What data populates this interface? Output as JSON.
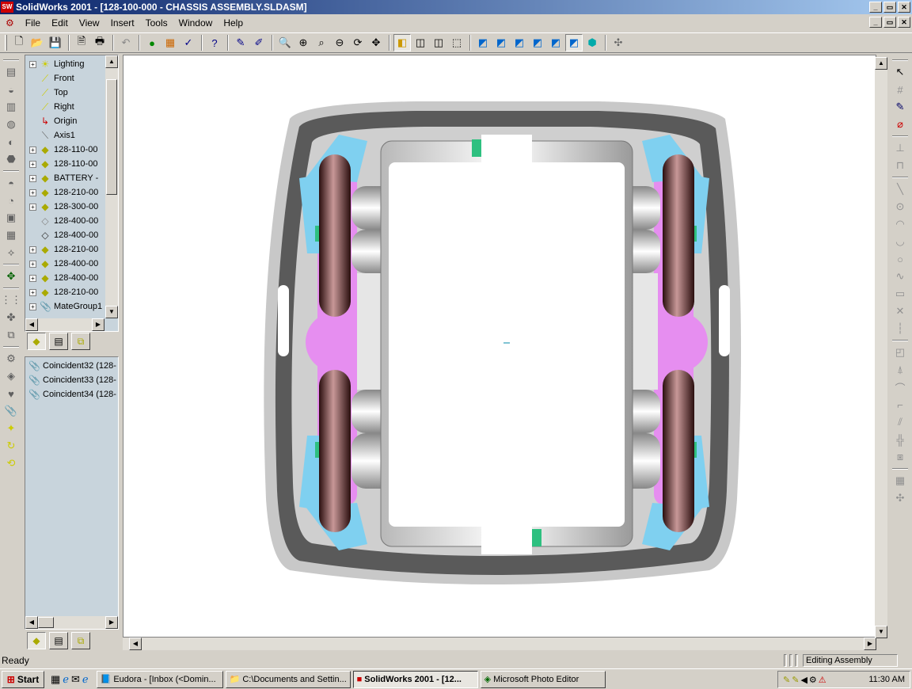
{
  "window": {
    "app_icon_text": "SW",
    "title": "SolidWorks 2001 - [128-100-000 - CHASSIS ASSEMBLY.SLDASM]",
    "controls": {
      "minimize": "_",
      "restore": "▭",
      "close": "✕"
    }
  },
  "menu": {
    "items": [
      "File",
      "Edit",
      "View",
      "Insert",
      "Tools",
      "Window",
      "Help"
    ]
  },
  "toolbar": {
    "icons": [
      "new-icon",
      "open-icon",
      "save-icon",
      "print-preview-icon",
      "print-icon",
      "undo-icon",
      "traffic-light-icon",
      "color-icon",
      "check-icon",
      "whats-this-icon",
      "select-icon",
      "filter-icon",
      "zoom-fit-icon",
      "zoom-in-icon",
      "zoom-box-icon",
      "zoom-out-icon",
      "rotate-icon",
      "pan-icon",
      "shaded-icon",
      "hidden-removed-icon",
      "hidden-gray-icon",
      "wireframe-icon",
      "front-view-icon",
      "back-view-icon",
      "left-view-icon",
      "right-view-icon",
      "top-view-icon",
      "isometric-view-icon",
      "move-component-icon"
    ]
  },
  "feature_tree": {
    "items": [
      {
        "label": "Lighting",
        "expandable": true,
        "icon": "lighting-icon"
      },
      {
        "label": "Front",
        "expandable": false,
        "icon": "plane-icon"
      },
      {
        "label": "Top",
        "expandable": false,
        "icon": "plane-icon"
      },
      {
        "label": "Right",
        "expandable": false,
        "icon": "plane-icon"
      },
      {
        "label": "Origin",
        "expandable": false,
        "icon": "origin-icon"
      },
      {
        "label": "Axis1",
        "expandable": false,
        "icon": "axis-icon"
      },
      {
        "label": "128-110-00",
        "expandable": true,
        "icon": "part-icon"
      },
      {
        "label": "128-110-00",
        "expandable": true,
        "icon": "part-icon"
      },
      {
        "label": "BATTERY -",
        "expandable": true,
        "icon": "part-icon"
      },
      {
        "label": "128-210-00",
        "expandable": true,
        "icon": "part-icon"
      },
      {
        "label": "128-300-00",
        "expandable": true,
        "icon": "part-icon"
      },
      {
        "label": "128-400-00",
        "expandable": false,
        "icon": "part-hidden-icon"
      },
      {
        "label": "128-400-00",
        "expandable": false,
        "icon": "part-hidden-icon"
      },
      {
        "label": "128-210-00",
        "expandable": true,
        "icon": "part-icon"
      },
      {
        "label": "128-400-00",
        "expandable": true,
        "icon": "part-icon"
      },
      {
        "label": "128-400-00",
        "expandable": true,
        "icon": "part-icon"
      },
      {
        "label": "128-210-00",
        "expandable": true,
        "icon": "part-icon"
      },
      {
        "label": "MateGroup1",
        "expandable": true,
        "icon": "mategroup-icon"
      }
    ]
  },
  "mates": {
    "items": [
      "Coincident32 (128-",
      "Coincident33 (128-",
      "Coincident34 (128-"
    ]
  },
  "status": {
    "left": "Ready",
    "right": "Editing Assembly"
  },
  "taskbar": {
    "start": "Start",
    "tasks": [
      {
        "label": "Eudora - [Inbox (<Domin...",
        "active": false,
        "icon": "eudora-icon"
      },
      {
        "label": "C:\\Documents and Settin...",
        "active": false,
        "icon": "folder-icon"
      },
      {
        "label": "SolidWorks 2001 - [12...",
        "active": true,
        "icon": "solidworks-icon"
      },
      {
        "label": "Microsoft Photo Editor",
        "active": false,
        "icon": "photo-editor-icon"
      }
    ],
    "clock": "11:30 AM"
  },
  "colors": {
    "title_start": "#0a246a",
    "title_end": "#a6caf0",
    "tree_bg": "#c8d4dc",
    "wheel": "#5a2a2a",
    "magenta": "#e68ef0",
    "cyan": "#7fd0f0"
  }
}
